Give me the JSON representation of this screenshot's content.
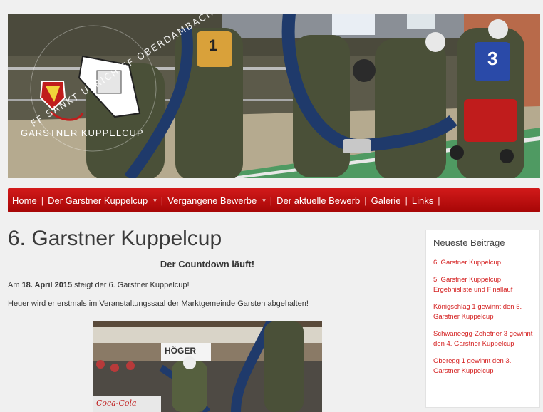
{
  "banner": {
    "logo_text_arc": "FF SANKT ULRICH FF OBERDAMBACH",
    "logo_subtitle": "GARSTNER KUPPELCUP",
    "bib_numbers": [
      "1",
      "3"
    ]
  },
  "nav": {
    "items": [
      {
        "label": "Home"
      },
      {
        "label": "Der Garstner Kuppelcup",
        "dropdown": true
      },
      {
        "label": "Vergangene Bewerbe",
        "dropdown": true
      },
      {
        "label": "Der aktuelle Bewerb"
      },
      {
        "label": "Galerie"
      },
      {
        "label": "Links"
      }
    ],
    "separator": "|",
    "caret": "▾"
  },
  "main": {
    "title": "6. Garstner Kuppelcup",
    "countdown": "Der Countdown läuft!",
    "p1_prefix": "Am ",
    "p1_date": "18. April 2015",
    "p1_suffix": " steigt der 6. Garstner Kuppelcup!",
    "p2": "Heuer wird er erstmals im Veranstaltungssaal der Marktgemeinde Garsten abgehalten!",
    "photo_sign": "HÖGER",
    "photo_ad": "Coca-Cola"
  },
  "sidebar": {
    "heading": "Neueste Beiträge",
    "posts": [
      "6. Garstner Kuppelcup",
      "5. Garstner Kuppelcup Ergebnisliste und Finallauf",
      "Königschlag 1 gewinnt den 5. Garstner Kuppelcup",
      "Schwaneegg-Zehetner 3 gewinnt den 4. Garstner Kuppelcup",
      "Oberegg 1 gewinnt den 3. Garstner Kuppelcup"
    ]
  },
  "colors": {
    "nav_red": "#c00d0d",
    "link_red": "#d41f1f",
    "background": "#f0f0f0"
  }
}
